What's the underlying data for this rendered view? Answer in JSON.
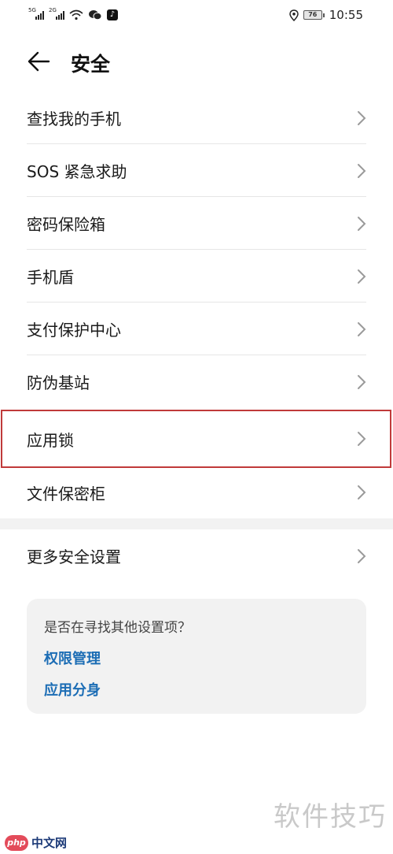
{
  "status_bar": {
    "sim1": "5G",
    "sim2": "2G",
    "battery": "76",
    "time": "10:55",
    "icons": [
      "signal-icon",
      "wifi-icon",
      "wechat-icon",
      "tiktok-icon",
      "location-icon",
      "battery-icon"
    ]
  },
  "header": {
    "title": "安全",
    "back_icon": "arrow-left-icon"
  },
  "menu": {
    "items": [
      {
        "label": "查找我的手机"
      },
      {
        "label": "SOS 紧急求助"
      },
      {
        "label": "密码保险箱"
      },
      {
        "label": "手机盾"
      },
      {
        "label": "支付保护中心"
      },
      {
        "label": "防伪基站"
      },
      {
        "label": "应用锁"
      },
      {
        "label": "文件保密柜"
      }
    ],
    "more": {
      "label": "更多安全设置"
    }
  },
  "suggestion": {
    "question": "是否在寻找其他设置项？",
    "links": [
      "权限管理",
      "应用分身"
    ]
  },
  "watermark": {
    "text": "软件技巧",
    "logo_badge": "php",
    "logo_text": "中文网"
  },
  "colors": {
    "link": "#1c6db5",
    "highlight_border": "#c03a3a",
    "card_bg": "#f2f2f2"
  }
}
